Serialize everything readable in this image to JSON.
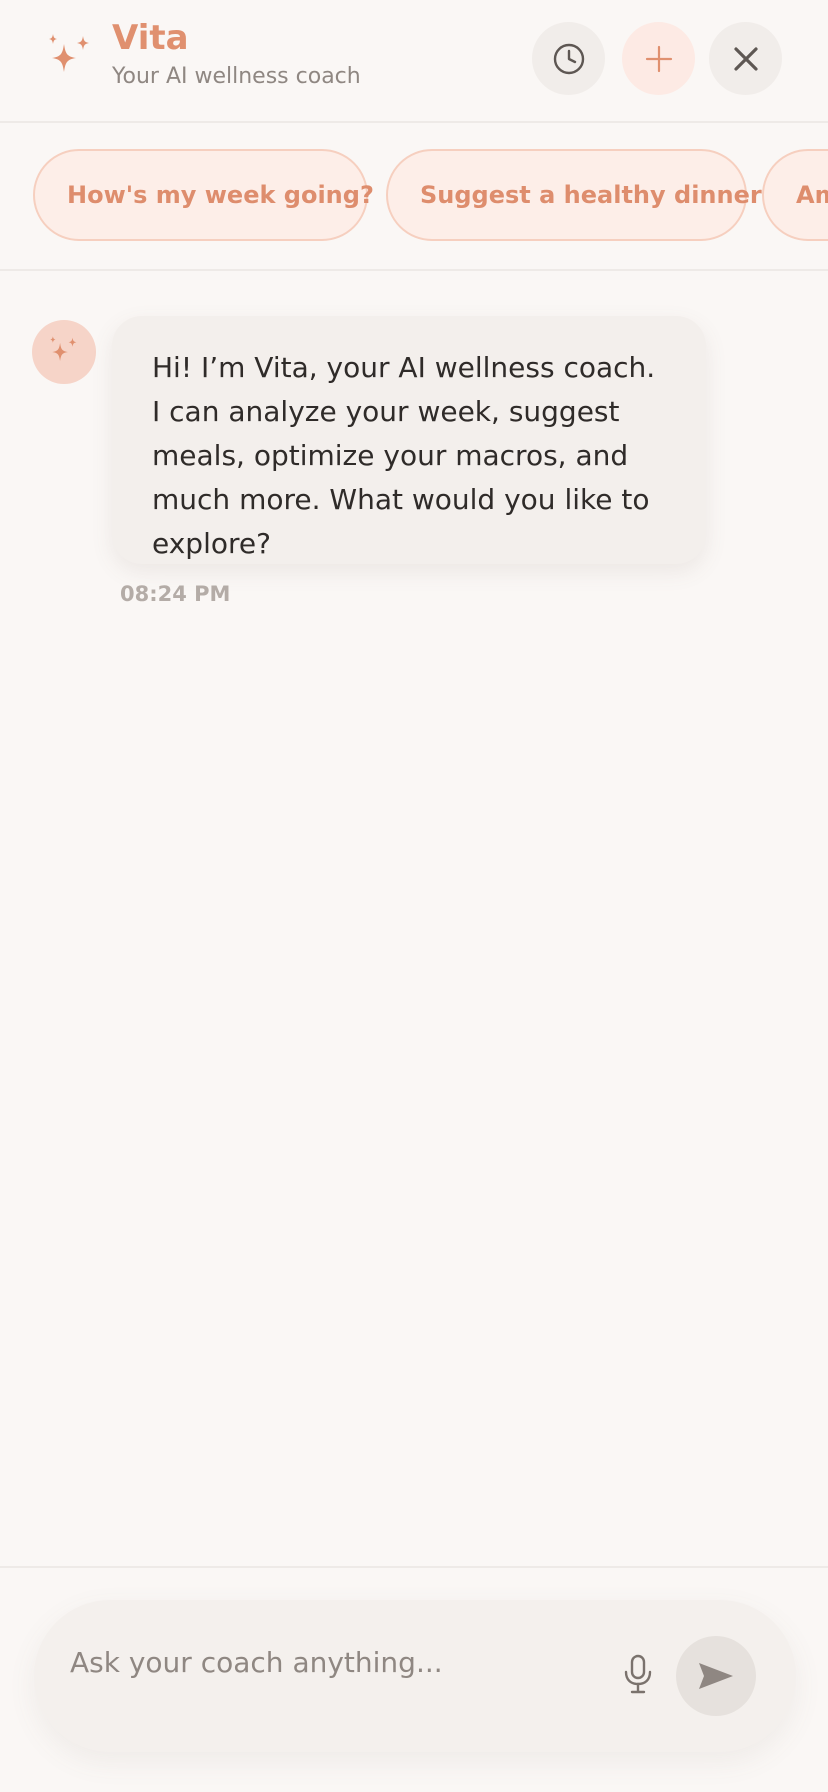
{
  "header": {
    "title": "Vita",
    "subtitle": "Your AI wellness coach",
    "brand_color": "#e0906f",
    "icons": {
      "logo": "sparkles-icon",
      "history": "clock-icon",
      "new_chat": "plus-icon",
      "close": "close-icon"
    }
  },
  "suggestions": [
    {
      "label": "How's my week going?"
    },
    {
      "label": "Suggest a healthy dinner"
    },
    {
      "label": "Am"
    }
  ],
  "messages": [
    {
      "sender": "coach",
      "avatar_icon": "sparkles-icon",
      "text": "Hi! I’m Vita, your AI wellness coach. I can analyze your week, suggest meals, optimize your macros, and much more. What would you like to explore?",
      "time": "08:24 PM"
    }
  ],
  "composer": {
    "placeholder": "Ask your coach anything...",
    "mic_icon": "microphone-icon",
    "send_icon": "send-icon"
  }
}
